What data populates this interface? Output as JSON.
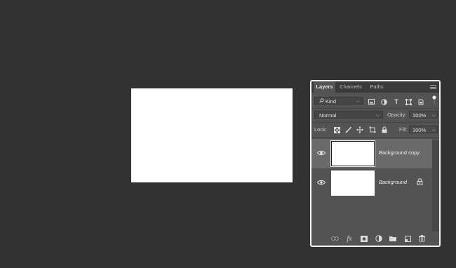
{
  "panel": {
    "tabs": [
      "Layers",
      "Channels",
      "Paths"
    ],
    "active_tab": "Layers",
    "filter": {
      "label": "Kind",
      "icons": [
        "image-filter-icon",
        "adjustment-filter-icon",
        "type-filter-icon",
        "shape-filter-icon",
        "smart-object-filter-icon",
        "filter-toggle-icon"
      ]
    },
    "blend_mode": "Normal",
    "opacity_label": "Opacity:",
    "opacity_value": "100%",
    "lock_label": "Lock:",
    "fill_label": "Fill:",
    "fill_value": "100%",
    "layers": [
      {
        "name": "Background copy",
        "selected": true,
        "italic": false,
        "locked": false
      },
      {
        "name": "Background",
        "selected": false,
        "italic": true,
        "locked": true
      }
    ],
    "bottom_icons": [
      "link-layers-icon",
      "fx-icon",
      "mask-icon",
      "adjustment-layer-icon",
      "folder-icon",
      "new-layer-icon",
      "trash-icon"
    ]
  },
  "colors": {
    "workspace": "#323232",
    "panel": "#535353",
    "selected_layer": "#6a6a6a"
  }
}
